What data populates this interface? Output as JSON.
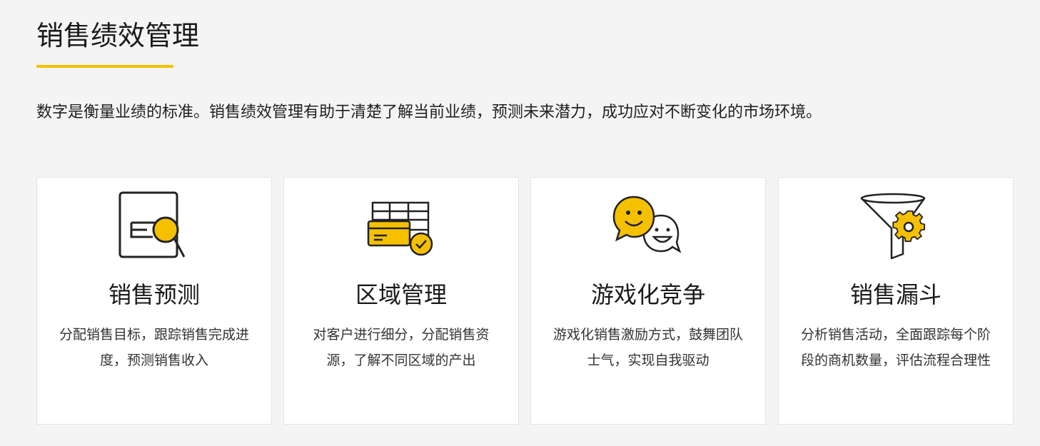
{
  "page": {
    "title": "销售绩效管理",
    "intro": "数字是衡量业绩的标准。销售绩效管理有助于清楚了解当前业绩，预测未来潜力，成功应对不断变化的市场环境。"
  },
  "colors": {
    "accent": "#f5c000",
    "outline": "#222222",
    "background": "#f4f4f4",
    "card": "#ffffff"
  },
  "cards": [
    {
      "icon": "document-search-icon",
      "title": "销售预测",
      "description": "分配销售目标，跟踪销售完成进度，预测销售收入"
    },
    {
      "icon": "table-card-check-icon",
      "title": "区域管理",
      "description": "对客户进行细分，分配销售资源，了解不同区域的产出"
    },
    {
      "icon": "chat-smile-icon",
      "title": "游戏化竞争",
      "description": "游戏化销售激励方式，鼓舞团队士气，实现自我驱动"
    },
    {
      "icon": "funnel-gear-icon",
      "title": "销售漏斗",
      "description": "分析销售活动，全面跟踪每个阶段的商机数量，评估流程合理性"
    }
  ]
}
